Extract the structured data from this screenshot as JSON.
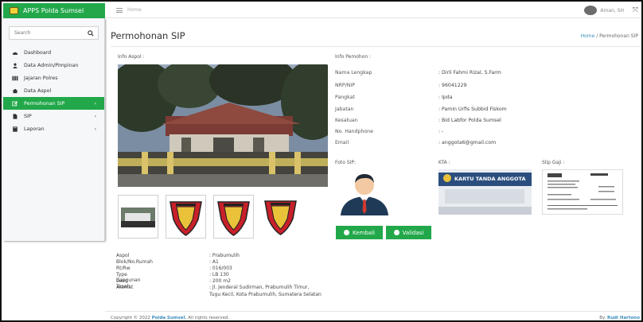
{
  "app": {
    "brand": "APPS Polda Sumsel"
  },
  "topbar": {
    "home": "Home",
    "user_name": "Aman, SH"
  },
  "sidebar": {
    "search_placeholder": "Search",
    "items": [
      {
        "label": "Dashboard",
        "icon": "dashboard-icon"
      },
      {
        "label": "Data Admin/Pimpinan",
        "icon": "user-icon"
      },
      {
        "label": "Jajaran Polres",
        "icon": "columns-icon"
      },
      {
        "label": "Data Aspol",
        "icon": "home-icon"
      },
      {
        "label": "Permohonan SIP",
        "icon": "edit-icon",
        "active": true,
        "chevron": "‹"
      },
      {
        "label": "SIP",
        "icon": "file-icon",
        "chevron": "‹"
      },
      {
        "label": "Laporan",
        "icon": "book-icon",
        "chevron": "‹"
      }
    ]
  },
  "page": {
    "title": "Permohonan SIP",
    "breadcrumb_home": "Home",
    "breadcrumb_sep": "/",
    "breadcrumb_current": "Permohonan SIP"
  },
  "info_aspol_label": "Info Aspol :",
  "info_pemohon_label": "Info Pemohon :",
  "pemohon": [
    {
      "key": "Nama Lengkap",
      "value": ": Dirli Fahmi Rizal, S.Farm"
    },
    {
      "key": "NRP/NIP",
      "value": ": 96041229"
    },
    {
      "key": "Pangkat",
      "value": ": Ipda"
    },
    {
      "key": "Jabatan",
      "value": ": Pamin Urfis Subbid Fiskom"
    },
    {
      "key": "Kesatuan",
      "value": ": Bid Labfor Polda Sumsel"
    },
    {
      "key": "No. Handphone",
      "value": ": -"
    },
    {
      "key": "Email",
      "value": ": anggota6@gmail.com"
    }
  ],
  "docs": {
    "foto_sip": "Foto SIP:",
    "kta": "KTA :",
    "kta_card_title": "KARTU TANDA ANGGOTA",
    "slip_gaji": "Slip Gaji :"
  },
  "buttons": {
    "kembali": "Kembali",
    "validasi": "Validasi"
  },
  "aspol_details": [
    {
      "key": "Aspol",
      "value": ": Prabumulih"
    },
    {
      "key": "Blok/No.Rumah",
      "value": ": A1"
    },
    {
      "key": "Rt/Rw",
      "value": ": 016/003"
    },
    {
      "key": "Type Bangunan",
      "value": ": LB 130"
    },
    {
      "key": "Luas Tanah",
      "value": ": 200 m2"
    },
    {
      "key": "Alamat",
      "value": ": Jl. Jenderal Sudirman, Prabumulih Timur,"
    },
    {
      "key": "",
      "value": "Tugu Kecil, Kota Prabumulih, Sumatera Selatan"
    }
  ],
  "footer": {
    "copyright_prefix": "Copyright © 2022",
    "copyright_org": "Polda Sumsel.",
    "copyright_suffix": "All rights reserved.",
    "by_prefix": "By.",
    "by_name": "Rudi Hartono"
  },
  "colors": {
    "accent": "#22a84a",
    "link": "#3c8dbc"
  }
}
